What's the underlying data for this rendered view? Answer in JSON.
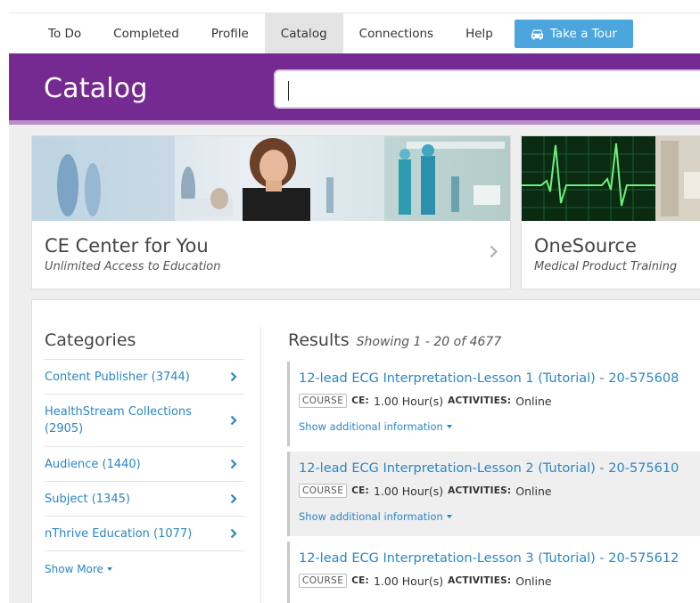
{
  "nav": {
    "items": [
      {
        "label": "To Do",
        "active": false
      },
      {
        "label": "Completed",
        "active": false
      },
      {
        "label": "Profile",
        "active": false
      },
      {
        "label": "Catalog",
        "active": true
      },
      {
        "label": "Connections",
        "active": false
      },
      {
        "label": "Help",
        "active": false
      }
    ],
    "tour_button": {
      "label": "Take a Tour",
      "icon": "car-icon"
    }
  },
  "header": {
    "title": "Catalog",
    "search": {
      "value": "",
      "placeholder": ""
    }
  },
  "promos": [
    {
      "title": "CE Center for You",
      "subtitle": "Unlimited Access to Education"
    },
    {
      "title": "OneSource",
      "subtitle": "Medical Product Training"
    }
  ],
  "categories": {
    "title": "Categories",
    "items": [
      {
        "label": "Content Publisher (3744)"
      },
      {
        "label": "HealthStream Collections (2905)"
      },
      {
        "label": "Audience (1440)"
      },
      {
        "label": "Subject (1345)"
      },
      {
        "label": "nThrive Education (1077)"
      }
    ],
    "show_more": "Show More"
  },
  "results": {
    "title": "Results",
    "showing": "Showing 1 - 20 of 4677",
    "items": [
      {
        "title": "12-lead ECG Interpretation-Lesson 1 (Tutorial) - 20-575608",
        "type": "COURSE",
        "ce_label": "CE:",
        "ce_value": "1.00 Hour(s)",
        "activities_label": "ACTIVITIES:",
        "activities_value": "Online",
        "more": "Show additional information"
      },
      {
        "title": "12-lead ECG Interpretation-Lesson 2 (Tutorial) - 20-575610",
        "type": "COURSE",
        "ce_label": "CE:",
        "ce_value": "1.00 Hour(s)",
        "activities_label": "ACTIVITIES:",
        "activities_value": "Online",
        "more": "Show additional information"
      },
      {
        "title": "12-lead ECG Interpretation-Lesson 3 (Tutorial) - 20-575612",
        "type": "COURSE",
        "ce_label": "CE:",
        "ce_value": "1.00 Hour(s)",
        "activities_label": "ACTIVITIES:",
        "activities_value": "Online",
        "more": "Show additional information"
      }
    ]
  },
  "colors": {
    "brand_purple": "#752a91",
    "link_blue": "#2a86c5",
    "tour_blue": "#4aa6dd"
  }
}
